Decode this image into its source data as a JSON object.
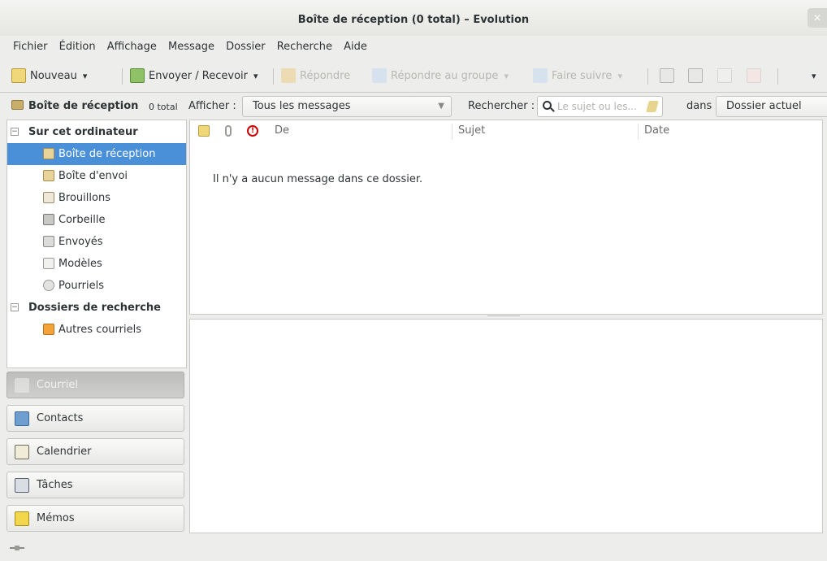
{
  "window": {
    "title": "Boîte de réception (0 total) – Evolution",
    "close_icon": "close-icon"
  },
  "menubar": [
    "Fichier",
    "Édition",
    "Affichage",
    "Message",
    "Dossier",
    "Recherche",
    "Aide"
  ],
  "toolbar": {
    "new_label": "Nouveau",
    "send_receive_label": "Envoyer / Recevoir",
    "reply_label": "Répondre",
    "reply_group_label": "Répondre au groupe",
    "forward_label": "Faire suivre"
  },
  "searchbar": {
    "folder_name": "Boîte de réception",
    "folder_count": "0 total",
    "show_label": "Afficher :",
    "filter_value": "Tous les messages",
    "search_label": "Rechercher :",
    "search_placeholder": "Le sujet ou les...",
    "in_label": "dans",
    "scope_value": "Dossier actuel"
  },
  "sidebar": {
    "group_local": "Sur cet ordinateur",
    "folders": [
      {
        "label": "Boîte de réception",
        "icon": "inbox-icon"
      },
      {
        "label": "Boîte d'envoi",
        "icon": "outbox-icon"
      },
      {
        "label": "Brouillons",
        "icon": "drafts-icon"
      },
      {
        "label": "Corbeille",
        "icon": "trash-icon"
      },
      {
        "label": "Envoyés",
        "icon": "sent-icon"
      },
      {
        "label": "Modèles",
        "icon": "templates-icon"
      },
      {
        "label": "Pourriels",
        "icon": "junk-icon"
      }
    ],
    "group_search": "Dossiers de recherche",
    "search_folders": [
      {
        "label": "Autres courriels",
        "icon": "search-folder-icon"
      }
    ]
  },
  "switcher": {
    "mail": "Courriel",
    "contacts": "Contacts",
    "calendar": "Calendrier",
    "tasks": "Tâches",
    "memos": "Mémos"
  },
  "message_list": {
    "columns": {
      "from": "De",
      "subject": "Sujet",
      "date": "Date"
    },
    "empty_text": "Il n'y a aucun message dans ce dossier."
  },
  "colors": {
    "selection": "#4a90d9",
    "window_bg": "#ededeb"
  }
}
